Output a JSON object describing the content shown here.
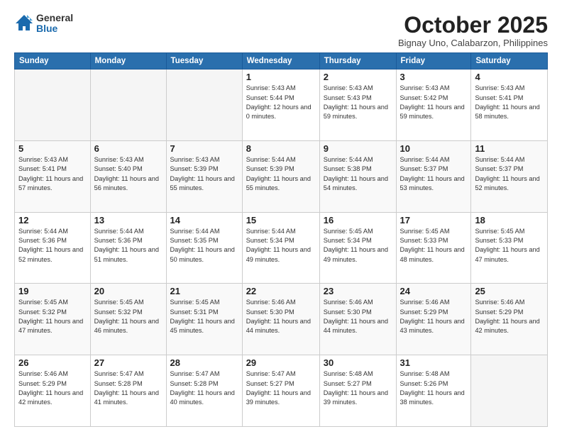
{
  "logo": {
    "general": "General",
    "blue": "Blue"
  },
  "header": {
    "month": "October 2025",
    "location": "Bignay Uno, Calabarzon, Philippines"
  },
  "weekdays": [
    "Sunday",
    "Monday",
    "Tuesday",
    "Wednesday",
    "Thursday",
    "Friday",
    "Saturday"
  ],
  "weeks": [
    [
      {
        "day": "",
        "info": ""
      },
      {
        "day": "",
        "info": ""
      },
      {
        "day": "",
        "info": ""
      },
      {
        "day": "1",
        "info": "Sunrise: 5:43 AM\nSunset: 5:44 PM\nDaylight: 12 hours\nand 0 minutes."
      },
      {
        "day": "2",
        "info": "Sunrise: 5:43 AM\nSunset: 5:43 PM\nDaylight: 11 hours\nand 59 minutes."
      },
      {
        "day": "3",
        "info": "Sunrise: 5:43 AM\nSunset: 5:42 PM\nDaylight: 11 hours\nand 59 minutes."
      },
      {
        "day": "4",
        "info": "Sunrise: 5:43 AM\nSunset: 5:41 PM\nDaylight: 11 hours\nand 58 minutes."
      }
    ],
    [
      {
        "day": "5",
        "info": "Sunrise: 5:43 AM\nSunset: 5:41 PM\nDaylight: 11 hours\nand 57 minutes."
      },
      {
        "day": "6",
        "info": "Sunrise: 5:43 AM\nSunset: 5:40 PM\nDaylight: 11 hours\nand 56 minutes."
      },
      {
        "day": "7",
        "info": "Sunrise: 5:43 AM\nSunset: 5:39 PM\nDaylight: 11 hours\nand 55 minutes."
      },
      {
        "day": "8",
        "info": "Sunrise: 5:44 AM\nSunset: 5:39 PM\nDaylight: 11 hours\nand 55 minutes."
      },
      {
        "day": "9",
        "info": "Sunrise: 5:44 AM\nSunset: 5:38 PM\nDaylight: 11 hours\nand 54 minutes."
      },
      {
        "day": "10",
        "info": "Sunrise: 5:44 AM\nSunset: 5:37 PM\nDaylight: 11 hours\nand 53 minutes."
      },
      {
        "day": "11",
        "info": "Sunrise: 5:44 AM\nSunset: 5:37 PM\nDaylight: 11 hours\nand 52 minutes."
      }
    ],
    [
      {
        "day": "12",
        "info": "Sunrise: 5:44 AM\nSunset: 5:36 PM\nDaylight: 11 hours\nand 52 minutes."
      },
      {
        "day": "13",
        "info": "Sunrise: 5:44 AM\nSunset: 5:36 PM\nDaylight: 11 hours\nand 51 minutes."
      },
      {
        "day": "14",
        "info": "Sunrise: 5:44 AM\nSunset: 5:35 PM\nDaylight: 11 hours\nand 50 minutes."
      },
      {
        "day": "15",
        "info": "Sunrise: 5:44 AM\nSunset: 5:34 PM\nDaylight: 11 hours\nand 49 minutes."
      },
      {
        "day": "16",
        "info": "Sunrise: 5:45 AM\nSunset: 5:34 PM\nDaylight: 11 hours\nand 49 minutes."
      },
      {
        "day": "17",
        "info": "Sunrise: 5:45 AM\nSunset: 5:33 PM\nDaylight: 11 hours\nand 48 minutes."
      },
      {
        "day": "18",
        "info": "Sunrise: 5:45 AM\nSunset: 5:33 PM\nDaylight: 11 hours\nand 47 minutes."
      }
    ],
    [
      {
        "day": "19",
        "info": "Sunrise: 5:45 AM\nSunset: 5:32 PM\nDaylight: 11 hours\nand 47 minutes."
      },
      {
        "day": "20",
        "info": "Sunrise: 5:45 AM\nSunset: 5:32 PM\nDaylight: 11 hours\nand 46 minutes."
      },
      {
        "day": "21",
        "info": "Sunrise: 5:45 AM\nSunset: 5:31 PM\nDaylight: 11 hours\nand 45 minutes."
      },
      {
        "day": "22",
        "info": "Sunrise: 5:46 AM\nSunset: 5:30 PM\nDaylight: 11 hours\nand 44 minutes."
      },
      {
        "day": "23",
        "info": "Sunrise: 5:46 AM\nSunset: 5:30 PM\nDaylight: 11 hours\nand 44 minutes."
      },
      {
        "day": "24",
        "info": "Sunrise: 5:46 AM\nSunset: 5:29 PM\nDaylight: 11 hours\nand 43 minutes."
      },
      {
        "day": "25",
        "info": "Sunrise: 5:46 AM\nSunset: 5:29 PM\nDaylight: 11 hours\nand 42 minutes."
      }
    ],
    [
      {
        "day": "26",
        "info": "Sunrise: 5:46 AM\nSunset: 5:29 PM\nDaylight: 11 hours\nand 42 minutes."
      },
      {
        "day": "27",
        "info": "Sunrise: 5:47 AM\nSunset: 5:28 PM\nDaylight: 11 hours\nand 41 minutes."
      },
      {
        "day": "28",
        "info": "Sunrise: 5:47 AM\nSunset: 5:28 PM\nDaylight: 11 hours\nand 40 minutes."
      },
      {
        "day": "29",
        "info": "Sunrise: 5:47 AM\nSunset: 5:27 PM\nDaylight: 11 hours\nand 39 minutes."
      },
      {
        "day": "30",
        "info": "Sunrise: 5:48 AM\nSunset: 5:27 PM\nDaylight: 11 hours\nand 39 minutes."
      },
      {
        "day": "31",
        "info": "Sunrise: 5:48 AM\nSunset: 5:26 PM\nDaylight: 11 hours\nand 38 minutes."
      },
      {
        "day": "",
        "info": ""
      }
    ]
  ]
}
